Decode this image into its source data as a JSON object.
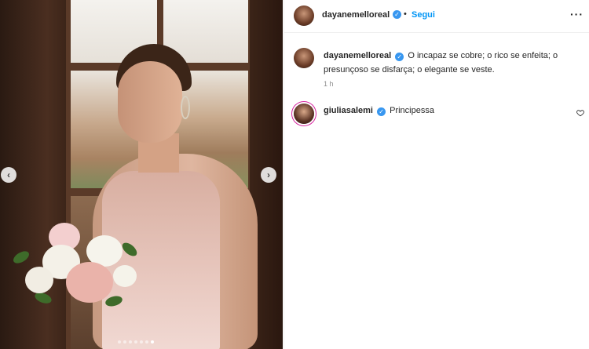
{
  "post": {
    "media": {
      "prev_icon": "chevron-left-icon",
      "next_icon": "chevron-right-icon",
      "prev_glyph": "‹",
      "next_glyph": "›",
      "carousel_count": 7,
      "carousel_active_index": 6
    },
    "header": {
      "username": "dayanemelloreal",
      "verified": true,
      "separator": "•",
      "follow_label": "Segui",
      "more_glyph": "···"
    },
    "caption": {
      "username": "dayanemelloreal",
      "verified": true,
      "text": "O incapaz se cobre; o rico se enfeita; o presunçoso se disfarça; o elegante se veste.",
      "timestamp": "1 h"
    },
    "comments": [
      {
        "username": "giuliasalemi",
        "verified": true,
        "text": "Principessa",
        "like_icon": "heart-icon"
      }
    ]
  },
  "colors": {
    "accent_blue": "#0095f6",
    "verified_blue": "#3897f0",
    "text_primary": "#262626",
    "text_secondary": "#8e8e8e",
    "story_ring": "#d6249f"
  }
}
